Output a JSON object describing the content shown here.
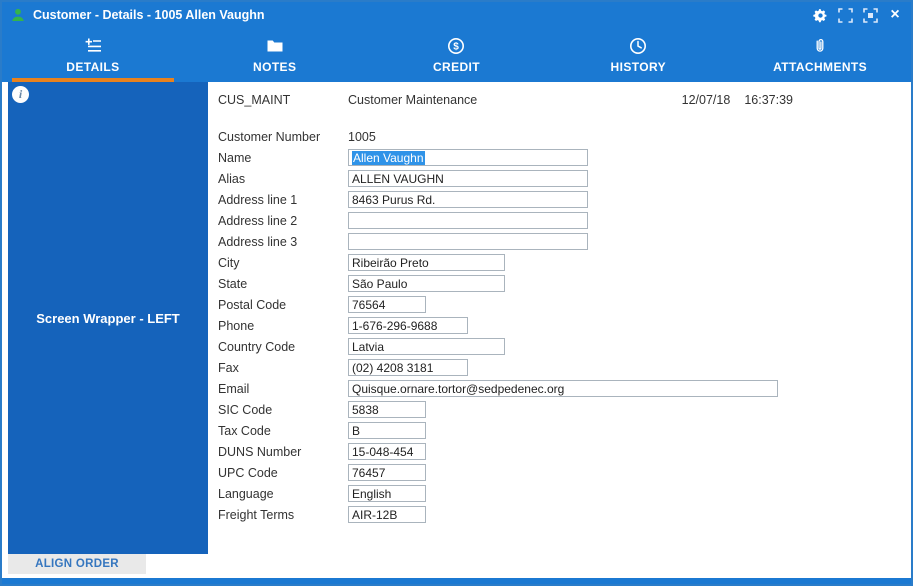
{
  "titlebar": {
    "title": "Customer - Details - 1005 Allen Vaughn",
    "close_glyph": "×",
    "icons": [
      "customer-person-icon",
      "settings-gear-icon",
      "fit-to-screen-icon",
      "resize-window-icon",
      "close-icon"
    ]
  },
  "tabs": [
    {
      "label": "DETAILS",
      "icon": "details-form-icon",
      "active": true
    },
    {
      "label": "NOTES",
      "icon": "folder-icon",
      "active": false
    },
    {
      "label": "CREDIT",
      "icon": "dollar-circle-icon",
      "active": false
    },
    {
      "label": "HISTORY",
      "icon": "clock-icon",
      "active": false
    },
    {
      "label": "ATTACHMENTS",
      "icon": "paperclip-icon",
      "active": false
    }
  ],
  "sidebar": {
    "label": "Screen Wrapper - LEFT",
    "info_glyph": "i"
  },
  "form": {
    "program": "CUS_MAINT",
    "title": "Customer Maintenance",
    "date": "12/07/18",
    "time": "16:37:39",
    "fields": [
      {
        "label": "Customer Number",
        "value": "1005",
        "plain": true
      },
      {
        "label": "Name",
        "value": "Allen Vaughn",
        "size": "w240",
        "selected": true
      },
      {
        "label": "Alias",
        "value": "ALLEN VAUGHN",
        "size": "w240"
      },
      {
        "label": "Address line 1",
        "value": "8463 Purus Rd.",
        "size": "w240"
      },
      {
        "label": "Address line 2",
        "value": "",
        "size": "w240"
      },
      {
        "label": "Address line 3",
        "value": "",
        "size": "w240"
      },
      {
        "label": "City",
        "value": "Ribeirão Preto",
        "size": "w157"
      },
      {
        "label": "State",
        "value": "São Paulo",
        "size": "w157"
      },
      {
        "label": "Postal Code",
        "value": "76564",
        "size": "w78"
      },
      {
        "label": "Phone",
        "value": "1-676-296-9688",
        "size": "w120"
      },
      {
        "label": "Country Code",
        "value": "Latvia",
        "size": "w157"
      },
      {
        "label": "Fax",
        "value": "(02) 4208 3181",
        "size": "w120"
      },
      {
        "label": "Email",
        "value": "Quisque.ornare.tortor@sedpedenec.org",
        "size": "w430"
      },
      {
        "label": "SIC Code",
        "value": "5838",
        "size": "w78"
      },
      {
        "label": "Tax Code",
        "value": "B",
        "size": "w78"
      },
      {
        "label": "DUNS Number",
        "value": "15-048-454",
        "size": "w78"
      },
      {
        "label": "UPC Code",
        "value": "76457",
        "size": "w78"
      },
      {
        "label": "Language",
        "value": "English",
        "size": "w78"
      },
      {
        "label": "Freight Terms",
        "value": "AIR-12B",
        "size": "w78"
      }
    ]
  },
  "footer": {
    "align_order": "ALIGN ORDER"
  },
  "colors": {
    "titlebar_blue": "#1b79d2",
    "sidebar_blue": "#1563bb",
    "active_tab_orange": "#e8821e",
    "selection_blue": "#2f93e8"
  }
}
